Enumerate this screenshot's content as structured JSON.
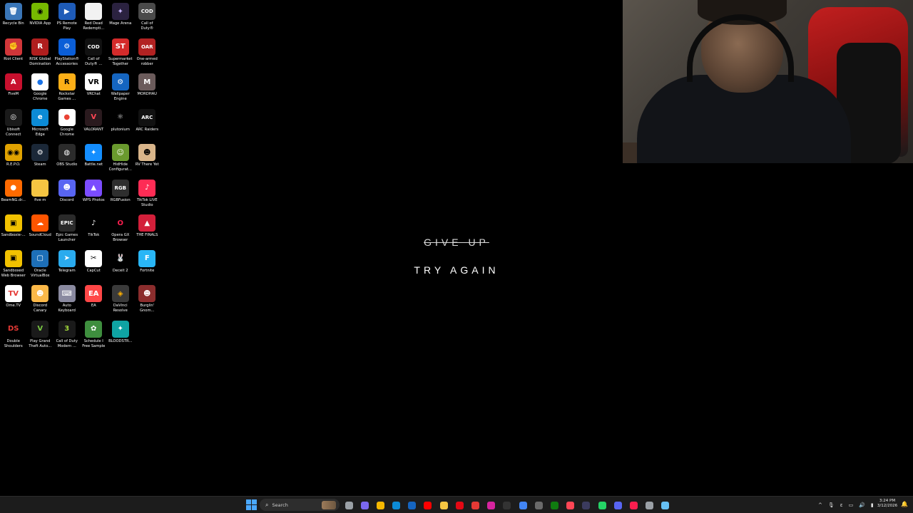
{
  "desktop": {
    "icons": [
      {
        "label": "Recycle Bin",
        "icon": "recycle-bin-icon",
        "glyph": "🗑",
        "bg": "#3a76b8",
        "fg": "#fff"
      },
      {
        "label": "NVIDIA App",
        "icon": "nvidia-icon",
        "glyph": "◉",
        "bg": "#76b900",
        "fg": "#000"
      },
      {
        "label": "PS Remote\nPlay",
        "icon": "ps-remote-play-icon",
        "glyph": "▶",
        "bg": "#1e5bb8",
        "fg": "#fff"
      },
      {
        "label": "Red Dead\nRedempti...",
        "icon": "document-icon",
        "glyph": "",
        "bg": "#f2f2f2",
        "fg": "#000"
      },
      {
        "label": "Mage Arena",
        "icon": "mage-arena-icon",
        "glyph": "✦",
        "bg": "#2b2240",
        "fg": "#c9b8ff"
      },
      {
        "label": "Call of\nDuty®",
        "icon": "call-of-duty-icon",
        "glyph": "COD",
        "bg": "#4a4a4a",
        "fg": "#fff"
      },
      {
        "label": "Riot Client",
        "icon": "riot-client-icon",
        "glyph": "✊",
        "bg": "#d13639",
        "fg": "#fff"
      },
      {
        "label": "RISK Global\nDomination",
        "icon": "risk-icon",
        "glyph": "R",
        "bg": "#b01e1e",
        "fg": "#fff"
      },
      {
        "label": "PlayStation®\nAccessories",
        "icon": "playstation-icon",
        "glyph": "⚙",
        "bg": "#0b5ed7",
        "fg": "#fff"
      },
      {
        "label": "Call of\nDuty® ...",
        "icon": "call-of-duty-icon",
        "glyph": "COD",
        "bg": "#111",
        "fg": "#fff"
      },
      {
        "label": "Supermarket\nTogether",
        "icon": "supermarket-icon",
        "glyph": "ST",
        "bg": "#d42b2b",
        "fg": "#fff"
      },
      {
        "label": "One-armed\nrobber",
        "icon": "one-armed-robber-icon",
        "glyph": "OAR",
        "bg": "#b22222",
        "fg": "#fff"
      },
      {
        "label": "FiveM",
        "icon": "fivem-icon",
        "glyph": "A",
        "bg": "#c8102e",
        "fg": "#fff"
      },
      {
        "label": "Google\nChrome",
        "icon": "chrome-icon",
        "glyph": "●",
        "bg": "#ffffff",
        "fg": "#1a73e8"
      },
      {
        "label": "Rockstar\nGames ...",
        "icon": "rockstar-icon",
        "glyph": "R",
        "bg": "#fcaf17",
        "fg": "#000"
      },
      {
        "label": "VRChat",
        "icon": "vrchat-icon",
        "glyph": "VR",
        "bg": "#ffffff",
        "fg": "#000"
      },
      {
        "label": "Wallpaper\nEngine",
        "icon": "wallpaper-engine-icon",
        "glyph": "⚙",
        "bg": "#1565c0",
        "fg": "#fff"
      },
      {
        "label": "MORDHAU",
        "icon": "mordhau-icon",
        "glyph": "M",
        "bg": "#6b5b5b",
        "fg": "#fff"
      },
      {
        "label": "Ubisoft\nConnect",
        "icon": "ubisoft-icon",
        "glyph": "◎",
        "bg": "#1a1a1a",
        "fg": "#fff"
      },
      {
        "label": "Microsoft\nEdge",
        "icon": "edge-icon",
        "glyph": "e",
        "bg": "#0c8bd6",
        "fg": "#fff"
      },
      {
        "label": "Google\nChrome",
        "icon": "chrome-icon",
        "glyph": "●",
        "bg": "#ffffff",
        "fg": "#ea4335"
      },
      {
        "label": "VALORANT",
        "icon": "valorant-icon",
        "glyph": "V",
        "bg": "#2a1a1e",
        "fg": "#ff4655"
      },
      {
        "label": "plutonium",
        "icon": "plutonium-icon",
        "glyph": "⚛",
        "bg": "#000",
        "fg": "#ddd"
      },
      {
        "label": "ARC Raiders",
        "icon": "arc-raiders-icon",
        "glyph": "ARC",
        "bg": "#111",
        "fg": "#fff"
      },
      {
        "label": "R.E.P.O.",
        "icon": "repo-icon",
        "glyph": "◉◉",
        "bg": "#e0a200",
        "fg": "#000"
      },
      {
        "label": "Steam",
        "icon": "steam-icon",
        "glyph": "⚙",
        "bg": "#1b2838",
        "fg": "#fff"
      },
      {
        "label": "OBS Studio",
        "icon": "obs-icon",
        "glyph": "◍",
        "bg": "#2b2b2b",
        "fg": "#fff"
      },
      {
        "label": "Battle.net",
        "icon": "battlenet-icon",
        "glyph": "✦",
        "bg": "#148eff",
        "fg": "#fff"
      },
      {
        "label": "HidHide\nConfigurat...",
        "icon": "hidhide-icon",
        "glyph": "☺",
        "bg": "#6a9a2e",
        "fg": "#fff"
      },
      {
        "label": "RV There Yet",
        "icon": "rv-there-yet-icon",
        "glyph": "☻",
        "bg": "#d9b58a",
        "fg": "#000"
      },
      {
        "label": "BeamNG.dr...",
        "icon": "beamng-icon",
        "glyph": "●",
        "bg": "#ff6a00",
        "fg": "#fff"
      },
      {
        "label": "five m",
        "icon": "folder-icon",
        "glyph": "",
        "bg": "#f5c542",
        "fg": "#000"
      },
      {
        "label": "Discord",
        "icon": "discord-icon",
        "glyph": "☻",
        "bg": "#5865f2",
        "fg": "#fff"
      },
      {
        "label": "WPS Photos",
        "icon": "wps-photos-icon",
        "glyph": "▲",
        "bg": "#7b4cff",
        "fg": "#fff"
      },
      {
        "label": "RGBFusion",
        "icon": "rgbfusion-icon",
        "glyph": "RGB",
        "bg": "#2e2e2e",
        "fg": "#fff"
      },
      {
        "label": "TikTok LIVE\nStudio",
        "icon": "tiktok-live-icon",
        "glyph": "♪",
        "bg": "#fe2c55",
        "fg": "#fff"
      },
      {
        "label": "Sandboxie-...",
        "icon": "sandboxie-icon",
        "glyph": "▣",
        "bg": "#f2c200",
        "fg": "#000"
      },
      {
        "label": "SoundCloud",
        "icon": "soundcloud-icon",
        "glyph": "☁",
        "bg": "#ff5500",
        "fg": "#fff"
      },
      {
        "label": "Epic Games\nLauncher",
        "icon": "epic-games-icon",
        "glyph": "EPIC",
        "bg": "#2a2a2a",
        "fg": "#fff"
      },
      {
        "label": "TikTok",
        "icon": "tiktok-icon",
        "glyph": "♪",
        "bg": "#000",
        "fg": "#fff"
      },
      {
        "label": "Opera GX\nBrowser",
        "icon": "opera-gx-icon",
        "glyph": "O",
        "bg": "#000",
        "fg": "#fa1e4e"
      },
      {
        "label": "THE FINALS",
        "icon": "the-finals-icon",
        "glyph": "▲",
        "bg": "#d31f3a",
        "fg": "#fff"
      },
      {
        "label": "Sandboxed\nWeb Browser",
        "icon": "sandboxed-browser-icon",
        "glyph": "▣",
        "bg": "#f2c200",
        "fg": "#000"
      },
      {
        "label": "Oracle\nVirtualBox",
        "icon": "virtualbox-icon",
        "glyph": "▢",
        "bg": "#1d6fb8",
        "fg": "#fff"
      },
      {
        "label": "Telegram",
        "icon": "telegram-icon",
        "glyph": "➤",
        "bg": "#2aabee",
        "fg": "#fff"
      },
      {
        "label": "CapCut",
        "icon": "capcut-icon",
        "glyph": "✂",
        "bg": "#fff",
        "fg": "#000"
      },
      {
        "label": "Deceit 2",
        "icon": "deceit-icon",
        "glyph": "🐰",
        "bg": "#000",
        "fg": "#fff"
      },
      {
        "label": "Fortnite",
        "icon": "fortnite-icon",
        "glyph": "F",
        "bg": "#29b6f6",
        "fg": "#fff"
      },
      {
        "label": "Ome.TV",
        "icon": "ometv-icon",
        "glyph": "TV",
        "bg": "#ffffff",
        "fg": "#e53935"
      },
      {
        "label": "Discord\nCanary",
        "icon": "discord-canary-icon",
        "glyph": "☻",
        "bg": "#fbb848",
        "fg": "#fff"
      },
      {
        "label": "Auto\nKeyboard",
        "icon": "auto-keyboard-icon",
        "glyph": "⌨",
        "bg": "#8a8aa0",
        "fg": "#fff"
      },
      {
        "label": "EA",
        "icon": "ea-icon",
        "glyph": "EA",
        "bg": "#ff4747",
        "fg": "#fff"
      },
      {
        "label": "DaVinci\nResolve",
        "icon": "davinci-resolve-icon",
        "glyph": "◈",
        "bg": "#3a3a3a",
        "fg": "#ffb000"
      },
      {
        "label": "Burglin'\nGnom...",
        "icon": "burglin-gnomes-icon",
        "glyph": "☻",
        "bg": "#8b2d2d",
        "fg": "#fff"
      },
      {
        "label": "Double\nShoulders",
        "icon": "double-shoulders-icon",
        "glyph": "DS",
        "bg": "#000",
        "fg": "#e53935"
      },
      {
        "label": "Play Grand\nTheft Auto...",
        "icon": "gta-v-icon",
        "glyph": "V",
        "bg": "#1a1a1a",
        "fg": "#7ac943"
      },
      {
        "label": "Call of Duty\nModern ...",
        "icon": "cod-mw3-icon",
        "glyph": "3",
        "bg": "#1a1a1a",
        "fg": "#a0d63a"
      },
      {
        "label": "Schedule I\nFree Sample",
        "icon": "schedule-one-icon",
        "glyph": "✿",
        "bg": "#3e8e3e",
        "fg": "#fff"
      },
      {
        "label": "BLOODSTR...",
        "icon": "bloodstrike-icon",
        "glyph": "✦",
        "bg": "#0fa3a3",
        "fg": "#fff"
      }
    ]
  },
  "overlay": {
    "give_up": "GIVE UP",
    "try_again": "TRY AGAIN"
  },
  "webcam": {
    "label": "webcam-feed"
  },
  "taskbar": {
    "search_placeholder": "Search",
    "apps": [
      {
        "name": "file-explorer-window",
        "color": "#9aa0a6"
      },
      {
        "name": "copilot",
        "color": "#7b68ee"
      },
      {
        "name": "chrome-canary",
        "color": "#f6b800"
      },
      {
        "name": "edge",
        "color": "#0c8bd6"
      },
      {
        "name": "outlook",
        "color": "#1565c0"
      },
      {
        "name": "youtube",
        "color": "#ff0000"
      },
      {
        "name": "file-explorer",
        "color": "#f5c542"
      },
      {
        "name": "netflix",
        "color": "#e50914"
      },
      {
        "name": "wps-office",
        "color": "#e53935"
      },
      {
        "name": "instagram",
        "color": "#d6249f"
      },
      {
        "name": "x",
        "color": "#333333"
      },
      {
        "name": "chrome",
        "color": "#4285f4"
      },
      {
        "name": "photos",
        "color": "#6a6a6a"
      },
      {
        "name": "xbox",
        "color": "#107c10"
      },
      {
        "name": "valorant",
        "color": "#ff4655"
      },
      {
        "name": "obs",
        "color": "#3b3b5e"
      },
      {
        "name": "whatsapp",
        "color": "#25d366"
      },
      {
        "name": "discord",
        "color": "#5865f2"
      },
      {
        "name": "opera-gx",
        "color": "#fa1e4e"
      },
      {
        "name": "settings",
        "color": "#9aa0a6"
      },
      {
        "name": "steam",
        "color": "#66c0f4"
      }
    ],
    "tray": {
      "chevron": "^",
      "mic": "🎙",
      "lang": "ε",
      "network": "▭",
      "volume": "🔊",
      "battery": "▮"
    },
    "clock": {
      "time": "3:24 PM",
      "date": "3/12/2026"
    }
  }
}
